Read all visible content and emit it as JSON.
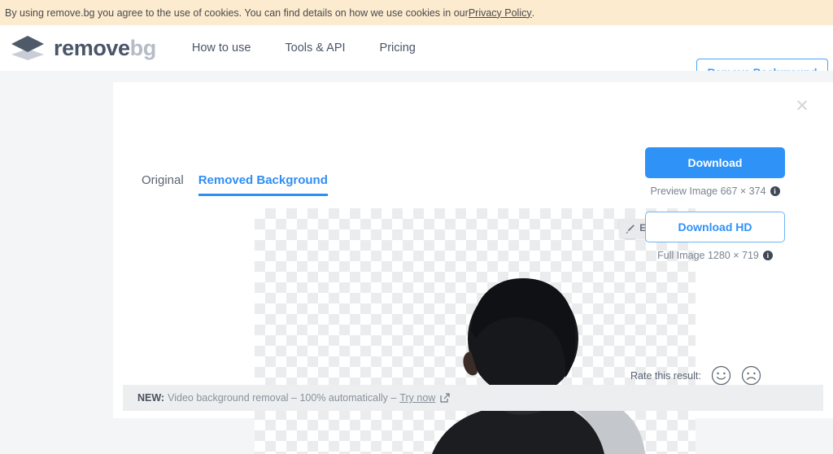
{
  "cookie_bar": {
    "text": "By using remove.bg you agree to the use of cookies. You can find details on how we use cookies in our ",
    "link_label": "Privacy Policy",
    "trailing": ".",
    "background_color": "#fdebd0"
  },
  "header": {
    "logo_icon": "layers-diamond-icon",
    "brand_primary": "remove",
    "brand_secondary": "bg",
    "nav": [
      {
        "label": "How to use",
        "name": "nav-how-to-use"
      },
      {
        "label": "Tools & API",
        "name": "nav-tools-api"
      },
      {
        "label": "Pricing",
        "name": "nav-pricing"
      }
    ],
    "cta_label": "Remove Background",
    "accent_color": "#3b9bf5"
  },
  "card": {
    "close_icon": "close-icon",
    "tabs": [
      {
        "label": "Original",
        "active": false
      },
      {
        "label": "Removed Background",
        "active": true
      }
    ],
    "preview": {
      "edit_label": "Edit",
      "edit_icon": "brush-icon",
      "edit_caret_icon": "chevron-down-icon",
      "background": "transparency-checkerboard",
      "subject": "person-from-behind-with-bag-strap"
    },
    "actions": {
      "download_label": "Download",
      "download_caption": "Preview Image 667 × 374",
      "download_info_icon": "info-icon",
      "download_hd_label": "Download HD",
      "download_hd_caption": "Full Image 1280 × 719",
      "download_hd_info_icon": "info-icon",
      "primary_color": "#2f92f7"
    },
    "rate": {
      "label": "Rate this result:",
      "positive_icon": "smiley-face-icon",
      "negative_icon": "frowny-face-icon"
    },
    "notice": {
      "badge": "NEW:",
      "text": "Video background removal – 100% automatically –",
      "link_label": "Try now",
      "link_icon": "external-link-icon"
    }
  }
}
